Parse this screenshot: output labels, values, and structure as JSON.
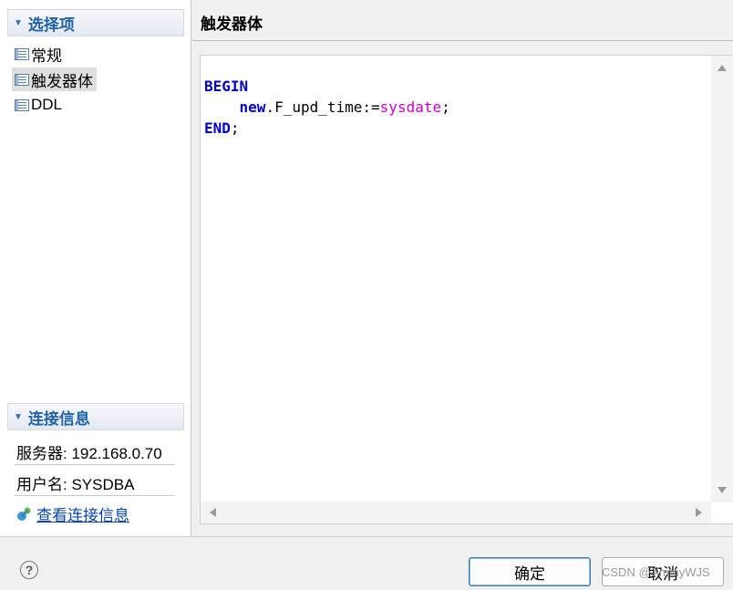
{
  "sidebar": {
    "section_title": "选择项",
    "items": [
      {
        "label": "常规"
      },
      {
        "label": "触发器体"
      },
      {
        "label": "DDL"
      }
    ]
  },
  "connection": {
    "section_title": "连接信息",
    "server": "服务器: 192.168.0.70",
    "user": "用户名: SYSDBA",
    "view_link": "查看连接信息"
  },
  "main": {
    "title": "触发器体",
    "code": {
      "line1_kw": "BEGIN",
      "line2_indent": "    ",
      "line2_kw": "new",
      "line2_mid": ".F_upd_time:=",
      "line2_fn": "sysdate",
      "line2_end": ";",
      "line3_kw": "END",
      "line3_end": ";"
    }
  },
  "footer": {
    "help_glyph": "?",
    "ok_label": "确定",
    "cancel_label": "取消",
    "watermark": "CSDN @JimmyWJS"
  },
  "colors": {
    "keyword": "#0000c8",
    "function": "#cc00cc",
    "section_title": "#1f63a8",
    "link": "#0645ad"
  }
}
